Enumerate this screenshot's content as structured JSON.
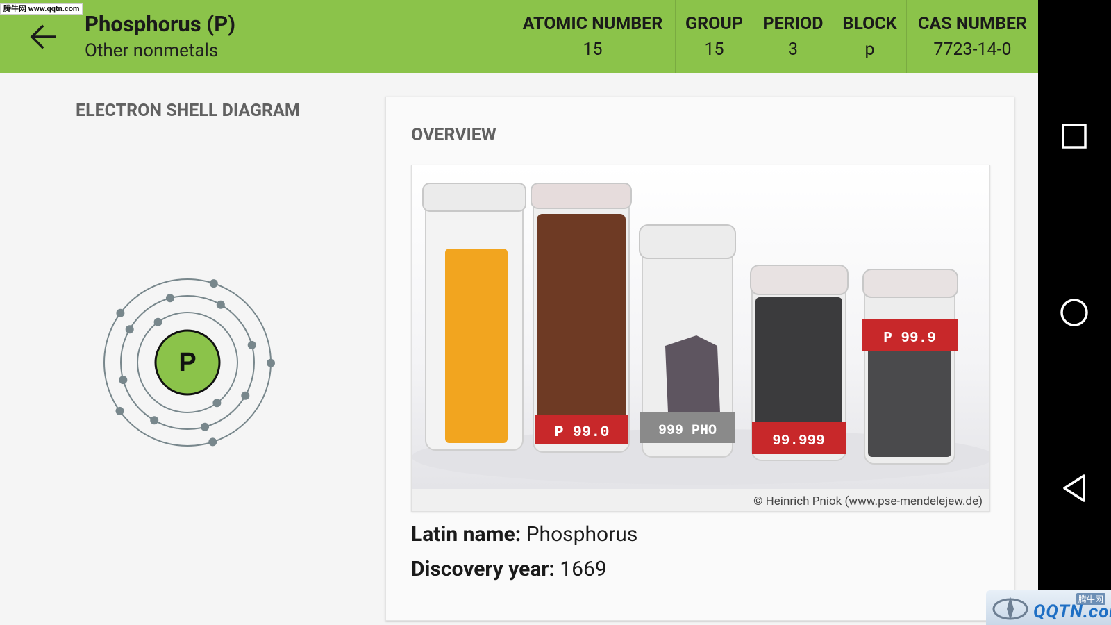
{
  "header": {
    "title": "Phosphorus (P)",
    "subtitle": "Other nonmetals",
    "stats": [
      {
        "label": "ATOMIC NUMBER",
        "value": "15"
      },
      {
        "label": "GROUP",
        "value": "15"
      },
      {
        "label": "PERIOD",
        "value": "3"
      },
      {
        "label": "BLOCK",
        "value": "p"
      },
      {
        "label": "CAS NUMBER",
        "value": "7723-14-0"
      }
    ]
  },
  "shell_diagram": {
    "title": "ELECTRON SHELL DIAGRAM",
    "symbol": "P",
    "shells": [
      2,
      8,
      5
    ]
  },
  "overview": {
    "title": "OVERVIEW",
    "image_credit": "© Heinrich Pniok (www.pse-mendelejew.de)",
    "jar_labels": [
      "P 99.0",
      "999 PHO",
      "99.999",
      "P 99.9"
    ],
    "facts": [
      {
        "label": "Latin name:",
        "value": "Phosphorus"
      },
      {
        "label": "Discovery year:",
        "value": "1669"
      }
    ]
  },
  "watermarks": {
    "top_left": "腾牛网 www.qqtn.com",
    "bottom_right_small": "腾牛网",
    "bottom_right_main": "QQTN.com"
  },
  "navbar": {
    "icons": [
      "recents-square-icon",
      "home-circle-icon",
      "back-triangle-icon"
    ]
  },
  "colors": {
    "header_green": "#8bc34a",
    "nucleus_green": "#8bc34a",
    "shell_grey": "#78878c"
  }
}
